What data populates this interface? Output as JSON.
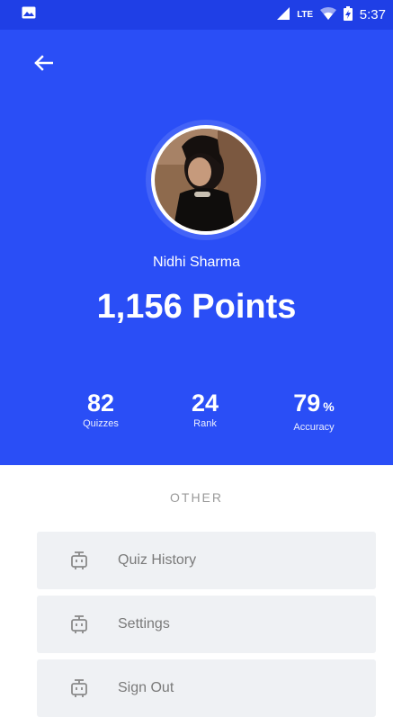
{
  "status_bar": {
    "network": "LTE",
    "time": "5:37",
    "icons": [
      "gallery-notification-icon",
      "signal-icon",
      "wifi-icon",
      "battery-charging-icon"
    ]
  },
  "header": {
    "back_icon": "arrow-left-icon",
    "background_color": "#2a4ef6"
  },
  "profile": {
    "name": "Nidhi Sharma",
    "points": "1,156 Points"
  },
  "stats": [
    {
      "value": "82",
      "unit": "",
      "label": "Quizzes"
    },
    {
      "value": "24",
      "unit": "",
      "label": "Rank"
    },
    {
      "value": "79",
      "unit": "%",
      "label": "Accuracy"
    }
  ],
  "other": {
    "title": "OTHER",
    "items": [
      {
        "label": "Quiz History",
        "icon": "robot-icon"
      },
      {
        "label": "Settings",
        "icon": "robot-icon"
      },
      {
        "label": "Sign Out",
        "icon": "robot-icon"
      }
    ]
  },
  "colors": {
    "accent": "#2a4ef6",
    "menu_background": "#eff1f4",
    "menu_text": "#7a7a7a"
  }
}
